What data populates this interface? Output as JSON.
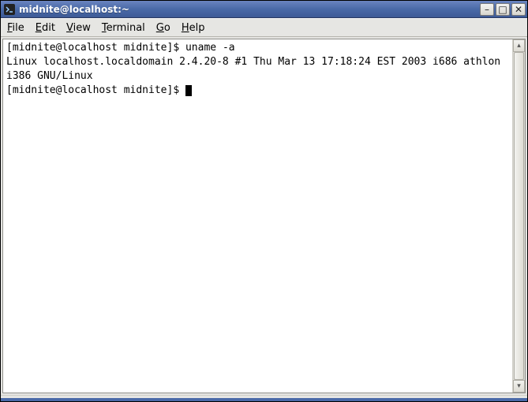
{
  "titlebar": {
    "app_icon": "terminal-icon",
    "title": "midnite@localhost:~",
    "buttons": {
      "minimize_glyph": "–",
      "maximize_glyph": "□",
      "close_glyph": "✕"
    }
  },
  "menubar": {
    "items": [
      {
        "underline": "F",
        "rest": "ile"
      },
      {
        "underline": "E",
        "rest": "dit"
      },
      {
        "underline": "V",
        "rest": "iew"
      },
      {
        "underline": "T",
        "rest": "erminal"
      },
      {
        "underline": "G",
        "rest": "o"
      },
      {
        "underline": "H",
        "rest": "elp"
      }
    ]
  },
  "terminal": {
    "prompt1_prefix": "[midnite@localhost midnite]$ ",
    "command1": "uname -a",
    "output1": "Linux localhost.localdomain 2.4.20-8 #1 Thu Mar 13 17:18:24 EST 2003 i686 athlon i386 GNU/Linux",
    "prompt2_prefix": "[midnite@localhost midnite]$ "
  },
  "scrollbar": {
    "up_glyph": "▴",
    "down_glyph": "▾"
  }
}
